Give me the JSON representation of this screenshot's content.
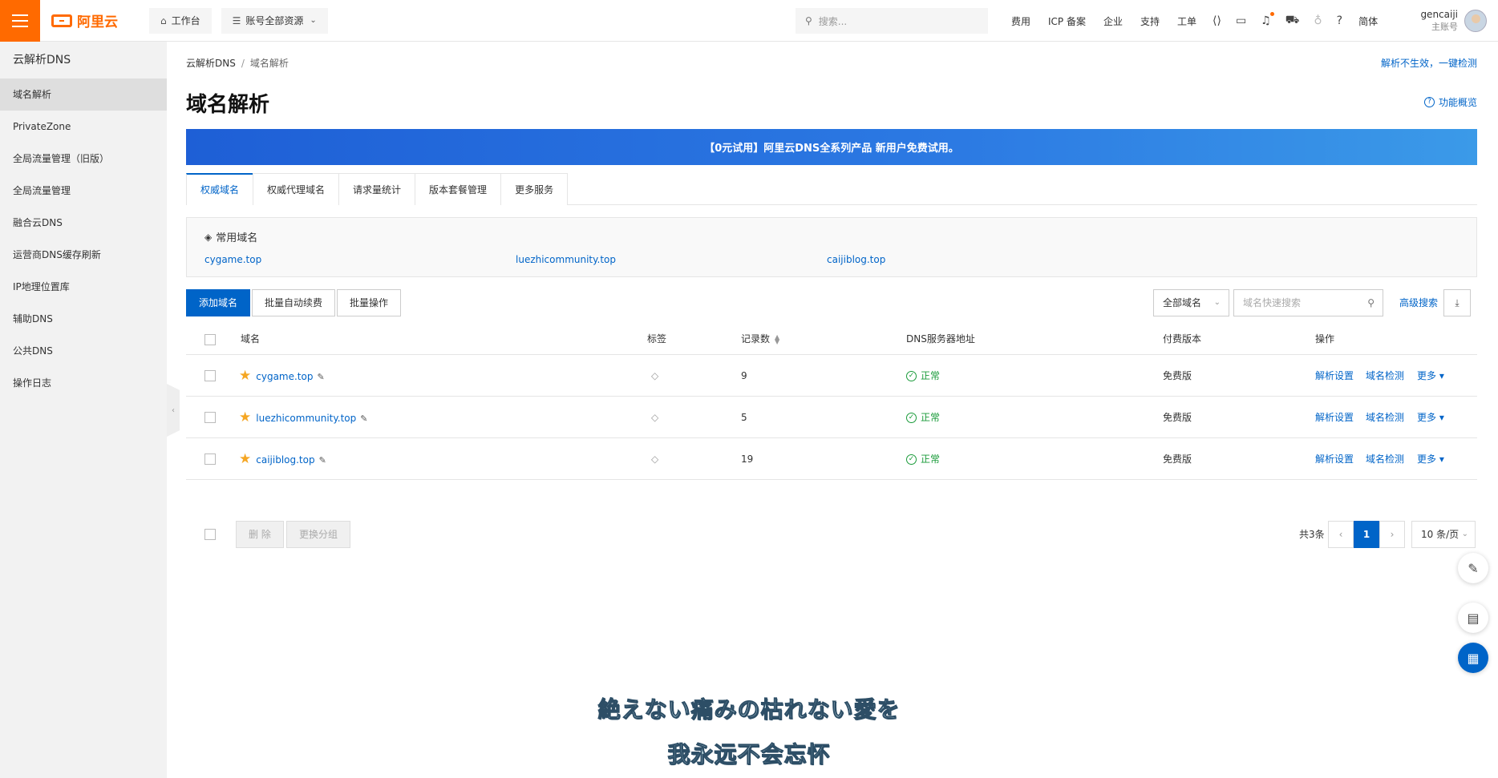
{
  "topbar": {
    "logo_text": "阿里云",
    "workbench": "工作台",
    "resources": "账号全部资源",
    "search_placeholder": "搜索...",
    "links": [
      "费用",
      "ICP 备案",
      "企业",
      "支持",
      "工单"
    ],
    "lang": "简体",
    "user_name": "gencaiji",
    "user_role": "主账号"
  },
  "sidebar": {
    "title": "云解析DNS",
    "items": [
      "域名解析",
      "PrivateZone",
      "全局流量管理（旧版）",
      "全局流量管理",
      "融合云DNS",
      "运营商DNS缓存刷新",
      "IP地理位置库",
      "辅助DNS",
      "公共DNS",
      "操作日志"
    ]
  },
  "breadcrumb": {
    "root": "云解析DNS",
    "current": "域名解析"
  },
  "help_link": "解析不生效，一键检测",
  "page_title": "域名解析",
  "overview_link": "功能概览",
  "banner": "【0元试用】阿里云DNS全系列产品 新用户免费试用。",
  "tabs": [
    "权威域名",
    "权威代理域名",
    "请求量统计",
    "版本套餐管理",
    "更多服务"
  ],
  "common_domains": {
    "title": "常用域名",
    "items": [
      "cygame.top",
      "luezhicommunity.top",
      "caijiblog.top"
    ]
  },
  "toolbar": {
    "add": "添加域名",
    "batch_renew": "批量自动续费",
    "batch_op": "批量操作",
    "filter": "全部域名",
    "quick_search_placeholder": "域名快速搜索",
    "advanced": "高级搜索"
  },
  "table": {
    "headers": [
      "域名",
      "标签",
      "记录数",
      "DNS服务器地址",
      "付费版本",
      "操作"
    ],
    "rows": [
      {
        "domain": "cygame.top",
        "records": "9",
        "dns": "正常",
        "plan": "免费版"
      },
      {
        "domain": "luezhicommunity.top",
        "records": "5",
        "dns": "正常",
        "plan": "免费版"
      },
      {
        "domain": "caijiblog.top",
        "records": "19",
        "dns": "正常",
        "plan": "免费版"
      }
    ],
    "ops": {
      "set": "解析设置",
      "check": "域名检测",
      "more": "更多"
    }
  },
  "footer": {
    "delete": "删 除",
    "change_group": "更换分组",
    "total": "共3条",
    "page": "1",
    "page_size": "10 条/页"
  },
  "subtitles": [
    "絶えない痛みの枯れない愛を",
    "我永远不会忘怀"
  ]
}
